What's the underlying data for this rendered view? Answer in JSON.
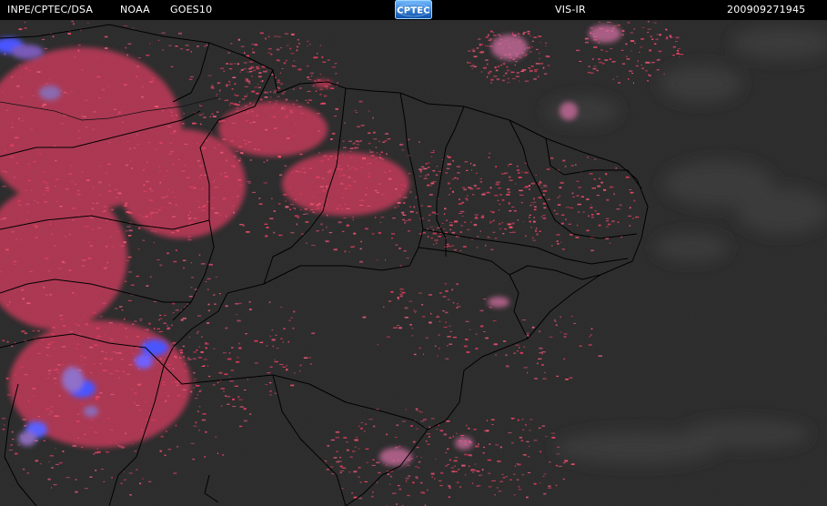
{
  "header": {
    "organization": "INPE/CPTEC/DSA",
    "agency": "NOAA",
    "satellite": "GOES10",
    "product": "VIS-IR",
    "timestamp": "200909271945",
    "logo_text": "CPTEC"
  },
  "colors": {
    "background": "#2a2a2a",
    "header_bar": "#000000",
    "header_text": "#ffffff",
    "cloud_ir": "#e04868",
    "cloud_cold": "#4060ff",
    "cloud_low": "#3c3c3c",
    "coastline": "#000000"
  }
}
